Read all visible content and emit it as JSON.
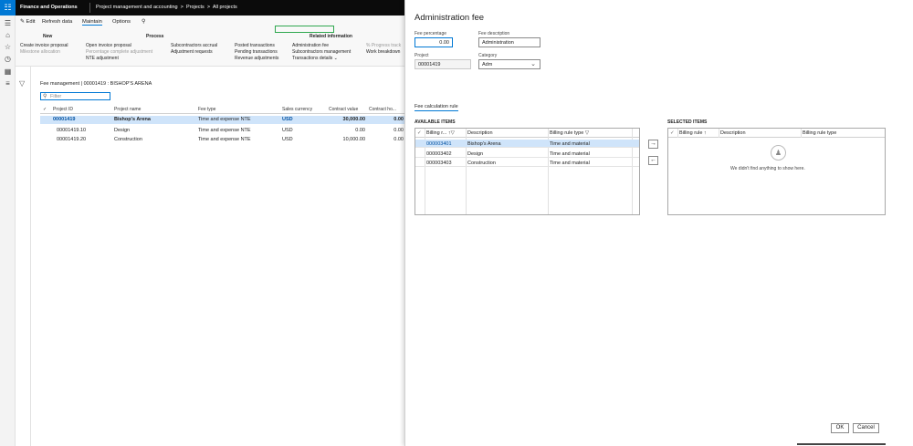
{
  "topbar": {
    "app_title": "Finance and Operations",
    "breadcrumb": [
      "Project management and accounting",
      "Projects",
      "All projects"
    ],
    "separator": ">"
  },
  "actionpane": {
    "tabs": [
      "Edit",
      "Refresh data",
      "Maintain",
      "Options"
    ],
    "groups": {
      "new": {
        "header": "New",
        "items": [
          "Create invoice proposal",
          "Milestone allocation"
        ]
      },
      "process": {
        "header": "Process",
        "col1": [
          "Open invoice proposal",
          "Percentage complete adjustment",
          "NTE adjustment"
        ],
        "col2": [
          "Subcontractors accrual",
          "Adjustment requests"
        ]
      },
      "related": {
        "header": "Related information",
        "col1": [
          "Posted transactions",
          "Pending transactions",
          "Revenue adjustments"
        ],
        "col2": [
          "Administration fee",
          "Subcontractors management",
          "Transactions details"
        ],
        "col3": [
          "% Progress track",
          "Work breakdown"
        ]
      }
    }
  },
  "grid": {
    "title": "Fee management  |  00001419 : BISHOP'S ARENA",
    "filter_placeholder": "Filter",
    "columns": [
      "Project ID",
      "Project name",
      "Fee type",
      "Sales currency",
      "Contract value",
      "Contract ho..."
    ],
    "rows": [
      {
        "id": "00001419",
        "name": "Bishop's Arena",
        "fee_type": "Time and expense NTE",
        "currency": "USD",
        "value": "30,000.00",
        "hours": "0.00"
      },
      {
        "id": "00001419.10",
        "name": "Design",
        "fee_type": "Time and expense NTE",
        "currency": "USD",
        "value": "0.00",
        "hours": "0.00"
      },
      {
        "id": "00001419.20",
        "name": "Construction",
        "fee_type": "Time and expense NTE",
        "currency": "USD",
        "value": "10,000.00",
        "hours": "0.00"
      }
    ]
  },
  "panel": {
    "title": "Administration fee",
    "fee_percentage_label": "Fee percentage",
    "fee_percentage_value": "0.00",
    "fee_description_label": "Fee description",
    "fee_description_value": "Administration",
    "project_label": "Project",
    "project_value": "00001419",
    "category_label": "Category",
    "category_value": "Adm",
    "section_tab": "Fee calculation rule",
    "available": {
      "header": "AVAILABLE ITEMS",
      "columns": [
        "Billing r...",
        "Description",
        "Billing rule type"
      ],
      "rows": [
        {
          "rule": "000003401",
          "desc": "Bishop's Arena",
          "type": "Time and material"
        },
        {
          "rule": "000003402",
          "desc": "Design",
          "type": "Time and material"
        },
        {
          "rule": "000003403",
          "desc": "Construction",
          "type": "Time and material"
        }
      ]
    },
    "selected": {
      "header": "SELECTED ITEMS",
      "columns": [
        "Billing rule",
        "Description",
        "Billing rule type"
      ],
      "empty_message": "We didn't find anything to show here."
    },
    "ok_label": "OK",
    "cancel_label": "Cancel"
  },
  "colors": {
    "accent": "#0078d4",
    "selection": "#cfe4fa",
    "highlight_box": "#2fa84f",
    "topbar": "#0b0b0b"
  }
}
